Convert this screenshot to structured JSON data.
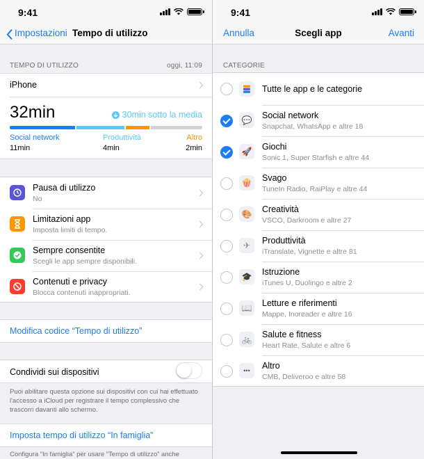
{
  "status": {
    "time": "9:41"
  },
  "left": {
    "nav": {
      "back_label": "Impostazioni",
      "title": "Tempo di utilizzo"
    },
    "usage": {
      "section_title": "TEMPO DI UTILIZZO",
      "timestamp": "oggi, 11:09",
      "device": "iPhone",
      "total": "32min",
      "comparison": "30min sotto la media",
      "categories": [
        {
          "name": "Social network",
          "time": "11min",
          "color": "#1b7cf5",
          "fraction": 0.34
        },
        {
          "name": "Produttività",
          "time": "4min",
          "color": "#5ac8fa",
          "fraction": 0.25
        },
        {
          "name": "Altro",
          "time": "2min",
          "color": "#ff9500",
          "fraction": 0.12
        }
      ],
      "remainder_color": "#d1d1d6"
    },
    "options": [
      {
        "title": "Pausa di utilizzo",
        "subtitle": "No",
        "icon": "hourglass-moon-icon",
        "color": "#5856d6"
      },
      {
        "title": "Limitazioni app",
        "subtitle": "Imposta limiti di tempo.",
        "icon": "hourglass-icon",
        "color": "#ff9500"
      },
      {
        "title": "Sempre consentite",
        "subtitle": "Scegli le app sempre disponibili.",
        "icon": "checkmark-badge-icon",
        "color": "#34c759"
      },
      {
        "title": "Contenuti e privacy",
        "subtitle": "Blocca contenuti inappropriati.",
        "icon": "no-entry-icon",
        "color": "#ff3b30"
      }
    ],
    "change_code": "Modifica codice “Tempo di utilizzo”",
    "share": {
      "label": "Condividi sui dispositivi",
      "enabled": false,
      "footnote": "Puoi abilitare questa opzione sui dispositivi con cui hai effettuato l'accesso a iCloud per registrare il tempo complessivo che trascorri davanti allo schermo."
    },
    "family": {
      "label": "Imposta tempo di utilizzo “In famiglia”",
      "footnote": "Configura “In famiglia” per usare “Tempo di utilizzo” anche"
    }
  },
  "right": {
    "nav": {
      "cancel_label": "Annulla",
      "title": "Scegli app",
      "next_label": "Avanti"
    },
    "section_title": "CATEGORIE",
    "all_label": "Tutte le app e le categorie",
    "categories": [
      {
        "title": "Social network",
        "subtitle": "Snapchat, WhatsApp e altre 18",
        "checked": true,
        "icon": "chat-bubble-heart-icon",
        "glyph": "💬"
      },
      {
        "title": "Giochi",
        "subtitle": "Sonic 1, Super Starfish e altre 44",
        "checked": true,
        "icon": "rocket-icon",
        "glyph": "🚀"
      },
      {
        "title": "Svago",
        "subtitle": "TuneIn Radio, RaiPlay e altre 44",
        "checked": false,
        "icon": "popcorn-icon",
        "glyph": "🍿"
      },
      {
        "title": "Creatività",
        "subtitle": "VSCO, Darkroom e altre 27",
        "checked": false,
        "icon": "palette-icon",
        "glyph": "🎨"
      },
      {
        "title": "Produttività",
        "subtitle": "iTranslate, Vignette e altre 81",
        "checked": false,
        "icon": "paper-plane-icon",
        "glyph": "✈"
      },
      {
        "title": "Istruzione",
        "subtitle": "iTunes U, Duolingo e altre 2",
        "checked": false,
        "icon": "globe-icon",
        "glyph": "🎓"
      },
      {
        "title": "Letture e riferimenti",
        "subtitle": "Mappe, Inoreader e altre 16",
        "checked": false,
        "icon": "book-icon",
        "glyph": "📖"
      },
      {
        "title": "Salute e fitness",
        "subtitle": "Heart Rate, Salute e altre 6",
        "checked": false,
        "icon": "bicycle-icon",
        "glyph": "🚲"
      },
      {
        "title": "Altro",
        "subtitle": "CMB, Deliveroo e altre 58",
        "checked": false,
        "icon": "ellipsis-icon",
        "glyph": "•••"
      }
    ]
  }
}
